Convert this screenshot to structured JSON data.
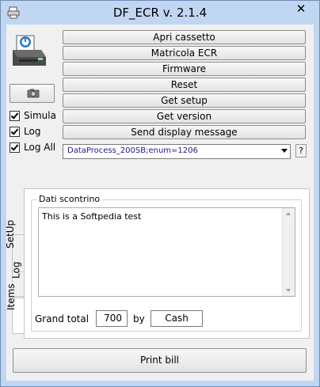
{
  "window": {
    "title": "DF_ECR v. 2.1.4",
    "close_glyph": "✕",
    "app_icon": "printer-icon",
    "title_bar_color": "#c1d6f2"
  },
  "commands": [
    "Apri cassetto",
    "Matricola ECR",
    "Firmware",
    "Reset",
    "Get setup",
    "Get version",
    "Send display message"
  ],
  "options": [
    {
      "label": "Simula",
      "checked": true
    },
    {
      "label": "Log",
      "checked": true
    },
    {
      "label": "Log All",
      "checked": true
    }
  ],
  "process_combo": {
    "value": "DataProcess_200SB;enum=1206"
  },
  "help_label": "?",
  "tabs": [
    "SetUp",
    "Log",
    "Items"
  ],
  "receipt": {
    "group_title": "Dati scontrino",
    "text": "This is a Softpedia test",
    "grand_total_label": "Grand total",
    "grand_total_value": "700",
    "by_label": "by",
    "payment_method": "Cash"
  },
  "print_button": "Print bill"
}
